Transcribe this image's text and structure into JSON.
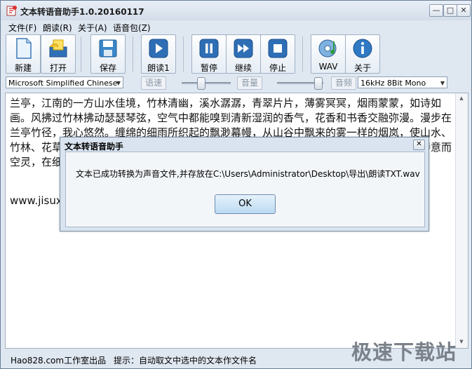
{
  "window": {
    "title": "文本转语音助手1.0.20160117",
    "controls": [
      "—",
      "□",
      "✕"
    ]
  },
  "menu": [
    "文件(F)",
    "朗读(R)",
    "关于(A)",
    "语音包(Z)"
  ],
  "toolbar": {
    "new": "新建",
    "open": "打开",
    "save": "保存",
    "read1": "朗读1",
    "pause": "暂停",
    "continue": "继续",
    "stop": "停止",
    "wav": "WAV",
    "about": "关于"
  },
  "options": {
    "voice": "Microsoft Simplified Chinese",
    "rate_label": "语速",
    "volume_label": "音量",
    "freq_label": "音频",
    "format": "16kHz  8Bit  Mono"
  },
  "editor": {
    "text": "兰亭，江南的一方山水佳境，竹林清幽，溪水潺潺，青翠片片，薄雾冥冥，烟雨蒙蒙，如诗如画。风拂过竹林拂动瑟瑟琴弦，空气中都能嗅到清新湿润的香气，花香和书香交融弥漫。漫步在兰亭竹径，我心悠然。缠绵的细雨所织起的飘渺幕幔，从山谷中飘来的雾一样的烟岚，使山水、竹林、花草在细雨中更加迷人。此情此景，不由得让人想起一千六百多年前的那场雅集，诗意而空灵，在细",
    "url": "www.jisux"
  },
  "dialog": {
    "title": "文本转语音助手",
    "message": "文本已成功转换为声音文件,并存放在C:\\Users\\Administrator\\Desktop\\导出\\朗读TXT.wav",
    "ok": "OK",
    "close": "✕"
  },
  "status": {
    "left": "Hao828.com工作室出品",
    "hint": "提示：自动取文中选中的文本作文件名"
  },
  "watermark": "极速下载站"
}
